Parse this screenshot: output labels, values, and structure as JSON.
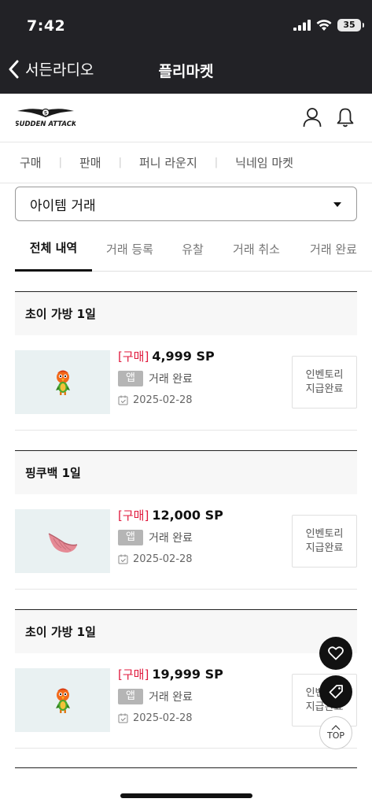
{
  "status_bar": {
    "time": "7:42",
    "battery": "35"
  },
  "nav": {
    "back_label": "서든라디오",
    "title": "플리마켓"
  },
  "header": {
    "logo_text": "SUDDEN ATTACK"
  },
  "menu": {
    "items": [
      "구매",
      "판매",
      "퍼니 라운지",
      "닉네임 마켓"
    ]
  },
  "dropdown": {
    "value": "아이템 거래"
  },
  "tabs": [
    "전체 내역",
    "거래 등록",
    "유찰",
    "거래 취소",
    "거래 완료"
  ],
  "items": [
    {
      "name": "초이 가방 1일",
      "type": "[구매]",
      "price": "4,999 SP",
      "badge": "앱",
      "status": "거래 완료",
      "date": "2025-02-28",
      "button": [
        "인벤토리",
        "지급완료"
      ],
      "thumb": "parrot-icon"
    },
    {
      "name": "핑쿠백 1일",
      "type": "[구매]",
      "price": "12,000 SP",
      "badge": "앱",
      "status": "거래 완료",
      "date": "2025-02-28",
      "button": [
        "인벤토리",
        "지급완료"
      ],
      "thumb": "pink-bag-icon"
    },
    {
      "name": "초이 가방 1일",
      "type": "[구매]",
      "price": "19,999 SP",
      "badge": "앱",
      "status": "거래 완료",
      "date": "2025-02-28",
      "button": [
        "인벤토리",
        "지급완료"
      ],
      "thumb": "parrot-icon"
    }
  ],
  "floating": {
    "top_label": "TOP"
  },
  "colors": {
    "topbar": "#222226",
    "accent_red": "#e0193d",
    "badge_gray": "#b5b5b5"
  }
}
